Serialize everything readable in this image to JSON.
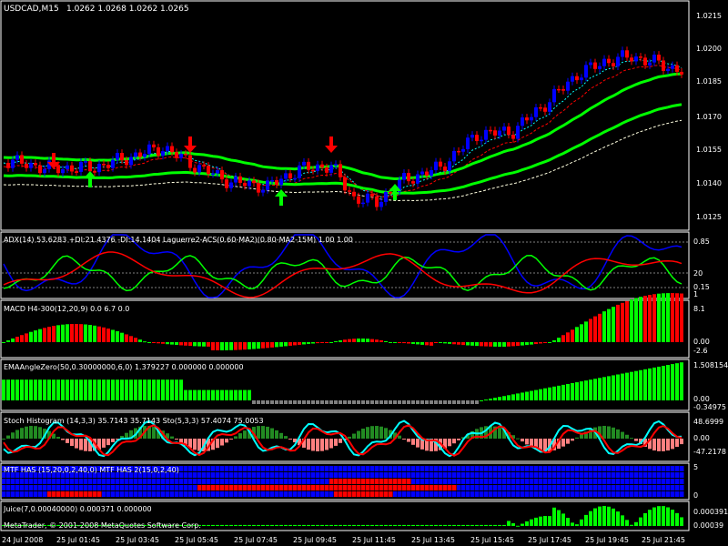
{
  "window": {
    "symbol_title": "USDCAD,M15",
    "ohlc": "1.0262 1.0268 1.0262 1.0265",
    "copyright": "MetaTrader, © 2001-2008 MetaQuotes Software Corp."
  },
  "colors": {
    "background": "#000000",
    "frame": "#ffffff",
    "bull_candle": "#0000ff",
    "bear_candle": "#ff0000",
    "ema_green": "#00ff00",
    "buy_arrow": "#00ff00",
    "sell_arrow": "#ff0000",
    "cyan": "#00ffff",
    "hist_red": "#ff0000",
    "hist_green": "#00ff00",
    "hist_gray": "#808080",
    "dark_green": "#228b22",
    "pink": "#ff8080"
  },
  "price_axis": {
    "labels": [
      "1.0215",
      "1.0200",
      "1.0185",
      "1.0170",
      "1.0155",
      "1.0140",
      "1.0125"
    ],
    "min": 1.012,
    "max": 1.022
  },
  "time_axis": {
    "labels": [
      "24 Jul 2008",
      "25 Jul 01:45",
      "25 Jul 03:45",
      "25 Jul 05:45",
      "25 Jul 07:45",
      "25 Jul 09:45",
      "25 Jul 11:45",
      "25 Jul 13:45",
      "25 Jul 15:45",
      "25 Jul 17:45",
      "25 Jul 19:45",
      "25 Jul 21:45"
    ]
  },
  "panels": {
    "adx": {
      "title": "ADX(14) 53.6283 +DI:21.4376 -DI:14.1404 Laguerre2-ACS(0.60-MA2)(0.80-MA2-15M) 1.00 1.00",
      "axis": [
        "0.85",
        "20",
        "0.15",
        "1"
      ]
    },
    "macd": {
      "title": "MACD H4-300(12,20,9) 0.0 6.7 0.0",
      "axis": [
        "8.1",
        "0.00",
        "-2.6"
      ]
    },
    "ema_angle": {
      "title": "EMAAngleZero(50,0.30000000,6,0) 1.379227 0.000000 0.000000",
      "axis": [
        "1.508154",
        "0.00",
        "-0.34975"
      ]
    },
    "stoch": {
      "title": "Stoch Histogram (14,3,3) 35.7143 35.7143 Sto(5,3,3) 57.4074 75.0053",
      "axis": [
        "48.6999",
        "0.00",
        "-47.2178"
      ]
    },
    "htf": {
      "title": "MTF HAS (15,20,0,2,40,0)  MTF HAS 2(15,0,2,40)",
      "axis": [
        "5",
        "0"
      ]
    },
    "juice": {
      "title": "Juice(7,0.00040000) 0.000371 0.000000",
      "axis": [
        "0.000391",
        "0.00039"
      ]
    }
  }
}
